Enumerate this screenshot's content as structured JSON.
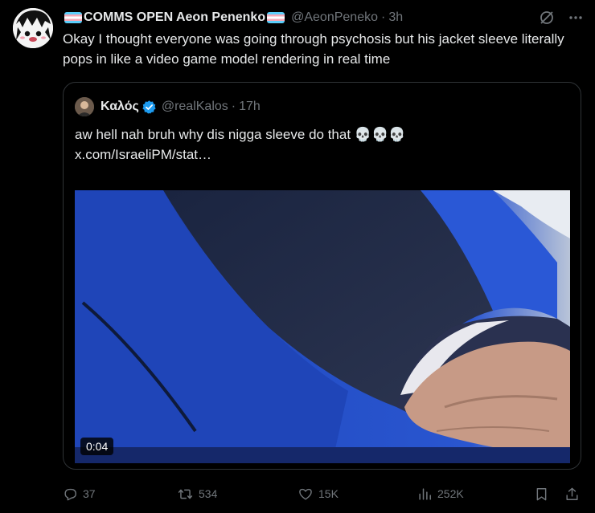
{
  "tweet": {
    "display_name": "COMMS OPEN Aeon Penenko",
    "handle": "@AeonPeneko",
    "separator": "·",
    "time": "3h",
    "text": "Okay I thought everyone was going through psychosis but his jacket sleeve literally pops in like a video game model rendering in real time"
  },
  "quote": {
    "display_name": "Καλός",
    "handle": "@realKalos",
    "separator": "·",
    "time": "17h",
    "text": "aw hell nah bruh why dis nigga sleeve do that 💀💀💀",
    "link": "x.com/IsraeliPM/stat…",
    "video_duration": "0:04"
  },
  "actions": {
    "replies": "37",
    "reposts": "534",
    "likes": "15K",
    "views": "252K"
  },
  "colors": {
    "background": "#000000",
    "text": "#e7e9ea",
    "muted": "#71767b",
    "border": "#2f3336",
    "verified": "#1d9bf0",
    "flag_blue": "#5bcefa",
    "flag_pink": "#f5a9b8"
  },
  "icons": [
    "grok-icon",
    "more-icon",
    "verified-badge-icon",
    "reply-icon",
    "repost-icon",
    "like-icon",
    "views-icon",
    "bookmark-icon",
    "share-icon"
  ]
}
